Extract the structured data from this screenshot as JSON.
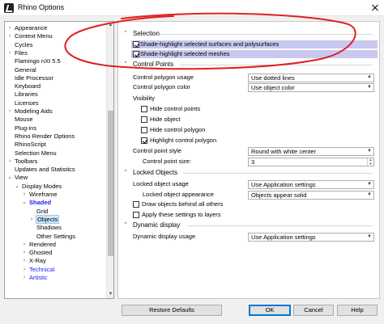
{
  "window": {
    "title": "Rhino Options"
  },
  "tree": [
    {
      "label": "Appearance",
      "chev": "›",
      "indent": 0
    },
    {
      "label": "Context Menu",
      "chev": "›",
      "indent": 0
    },
    {
      "label": "Cycles",
      "chev": "",
      "indent": 0
    },
    {
      "label": "Files",
      "chev": "›",
      "indent": 0
    },
    {
      "label": "Flamingo nXt 5.5",
      "chev": "",
      "indent": 0
    },
    {
      "label": "General",
      "chev": "",
      "indent": 0
    },
    {
      "label": "Idle Processor",
      "chev": "",
      "indent": 0
    },
    {
      "label": "Keyboard",
      "chev": "",
      "indent": 0
    },
    {
      "label": "Libraries",
      "chev": "",
      "indent": 0
    },
    {
      "label": "Licenses",
      "chev": "",
      "indent": 0
    },
    {
      "label": "Modeling Aids",
      "chev": "›",
      "indent": 0
    },
    {
      "label": "Mouse",
      "chev": "",
      "indent": 0
    },
    {
      "label": "Plug-ins",
      "chev": "",
      "indent": 0
    },
    {
      "label": "Rhino Render Options",
      "chev": "",
      "indent": 0
    },
    {
      "label": "RhinoScript",
      "chev": "",
      "indent": 0
    },
    {
      "label": "Selection Menu",
      "chev": "",
      "indent": 0
    },
    {
      "label": "Toolbars",
      "chev": "›",
      "indent": 0
    },
    {
      "label": "Updates and Statistics",
      "chev": "",
      "indent": 0
    },
    {
      "label": "View",
      "chev": "⌄",
      "indent": 0
    },
    {
      "label": "Display Modes",
      "chev": "⌄",
      "indent": 1
    },
    {
      "label": "Wireframe",
      "chev": "›",
      "indent": 2
    },
    {
      "label": "Shaded",
      "chev": "⌄",
      "indent": 2,
      "style": "bold"
    },
    {
      "label": "Grid",
      "chev": "",
      "indent": 3
    },
    {
      "label": "Objects",
      "chev": "›",
      "indent": 3,
      "selected": true
    },
    {
      "label": "Shadows",
      "chev": "",
      "indent": 3
    },
    {
      "label": "Other Settings",
      "chev": "",
      "indent": 3
    },
    {
      "label": "Rendered",
      "chev": "›",
      "indent": 2
    },
    {
      "label": "Ghosted",
      "chev": "›",
      "indent": 2
    },
    {
      "label": "X-Ray",
      "chev": "›",
      "indent": 2
    },
    {
      "label": "Technical",
      "chev": "›",
      "indent": 2,
      "style": "blue"
    },
    {
      "label": "Artistic",
      "chev": "›",
      "indent": 2,
      "style": "blue"
    }
  ],
  "selection": {
    "heading": "Selection",
    "shade_surfaces": "Shade-highlight selected surfaces and polysurfaces",
    "shade_meshes": "Shade-highlight selected meshes"
  },
  "control_points": {
    "heading": "Control Points",
    "polygon_usage_label": "Control polygon usage",
    "polygon_usage_value": "Use dotted lines",
    "polygon_color_label": "Control polygon color",
    "polygon_color_value": "Use object color",
    "visibility_label": "Visibility",
    "hide_control_points": "Hide control points",
    "hide_object": "Hide object",
    "hide_control_polygon": "Hide control polygon",
    "highlight_control_polygon": "Highlight control polygon",
    "point_style_label": "Control point style",
    "point_style_value": "Round with white center",
    "point_size_label": "Control point size:",
    "point_size_value": "3"
  },
  "locked_objects": {
    "heading": "Locked Objects",
    "usage_label": "Locked object usage",
    "usage_value": "Use Application settings",
    "appearance_label": "Locked object appearance",
    "appearance_value": "Objects appear solid",
    "draw_behind": "Draw objects behind all others",
    "apply_layers": "Apply these settings to layers"
  },
  "dynamic_display": {
    "heading": "Dynamic display",
    "usage_label": "Dynamic display usage",
    "usage_value": "Use Application settings"
  },
  "buttons": {
    "restore": "Restore Defaults",
    "ok": "OK",
    "cancel": "Cancel",
    "help": "Help"
  },
  "colors": {
    "highlight_row": "#c8c8f0",
    "annotation": "#e02020",
    "tree_blue": "#1a1aff",
    "ok_border": "#0078d7"
  }
}
